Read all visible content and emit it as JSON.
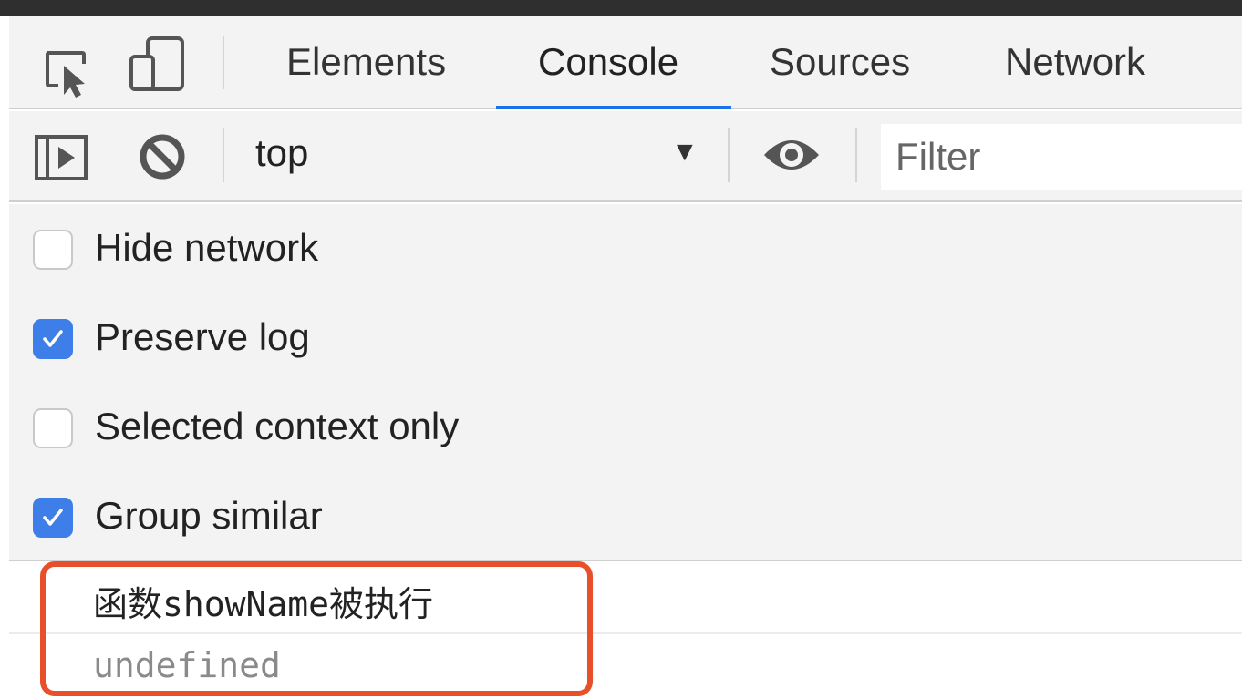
{
  "tabs": [
    {
      "label": "Elements"
    },
    {
      "label": "Console"
    },
    {
      "label": "Sources"
    },
    {
      "label": "Network"
    }
  ],
  "active_tab": "Console",
  "toolbar": {
    "context": "top",
    "filter_placeholder": "Filter"
  },
  "settings": [
    {
      "label": "Hide network",
      "checked": false
    },
    {
      "label": "Preserve log",
      "checked": true
    },
    {
      "label": "Selected context only",
      "checked": false
    },
    {
      "label": "Group similar",
      "checked": true
    }
  ],
  "console": {
    "log_message": "函数showName被执行",
    "result": "undefined"
  },
  "colors": {
    "accent": "#1a73e8",
    "checkbox_checked": "#3d7ee8",
    "highlight": "#e8502b",
    "panel_bg": "#f3f3f3"
  }
}
